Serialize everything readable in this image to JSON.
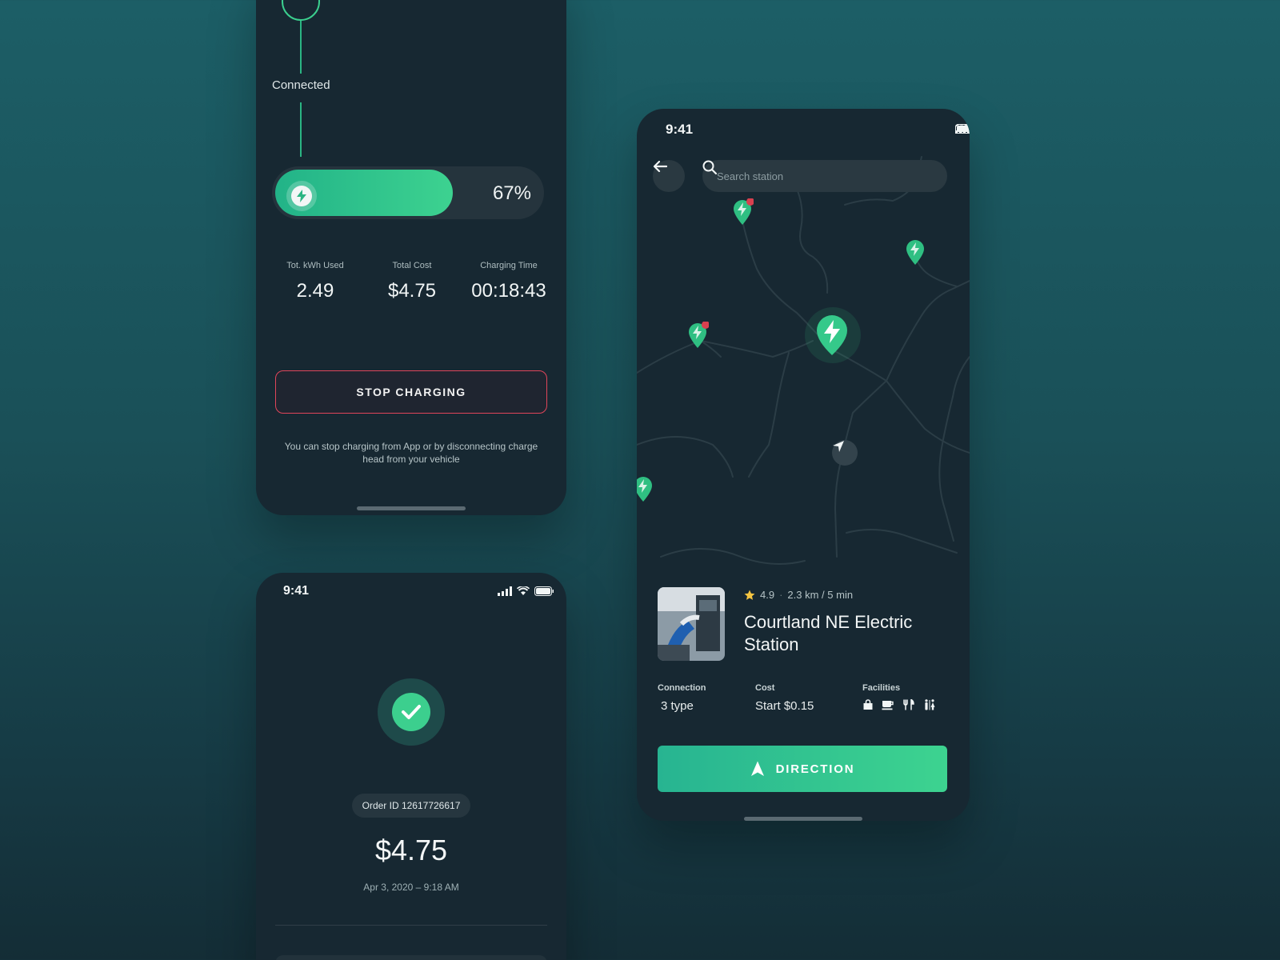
{
  "charging": {
    "step_label": "Connected",
    "progress_label": "67%",
    "progress_fraction": 0.67,
    "stats": [
      {
        "label": "Tot. kWh Used",
        "value": "2.49"
      },
      {
        "label": "Total Cost",
        "value": "$4.75"
      },
      {
        "label": "Charging Time",
        "value": "00:18:43"
      }
    ],
    "stop_button": "STOP CHARGING",
    "note": "You can stop charging from App or by disconnecting charge head from your vehicle"
  },
  "receipt": {
    "time": "9:41",
    "order_id": "Order ID 12617726617",
    "amount": "$4.75",
    "date": "Apr 3, 2020 – 9:18 AM"
  },
  "map": {
    "time": "9:41",
    "search_placeholder": "Search station",
    "station": {
      "rating": "4.9",
      "separator": "·",
      "distance": "2.3 km / 5 min",
      "name": "Courtland NE Electric Station",
      "connection_label": "Connection",
      "connection_value": "3 type",
      "cost_label": "Cost",
      "cost_value": "Start $0.15",
      "facilities_label": "Facilities",
      "facilities": [
        "shop-icon",
        "coffee-icon",
        "restaurant-icon",
        "restroom-icon"
      ]
    },
    "direction_button": "DIRECTION"
  },
  "colors": {
    "accent": "#3bcf8e",
    "danger": "#e0455a",
    "card": "#172832",
    "star": "#f5c542"
  }
}
